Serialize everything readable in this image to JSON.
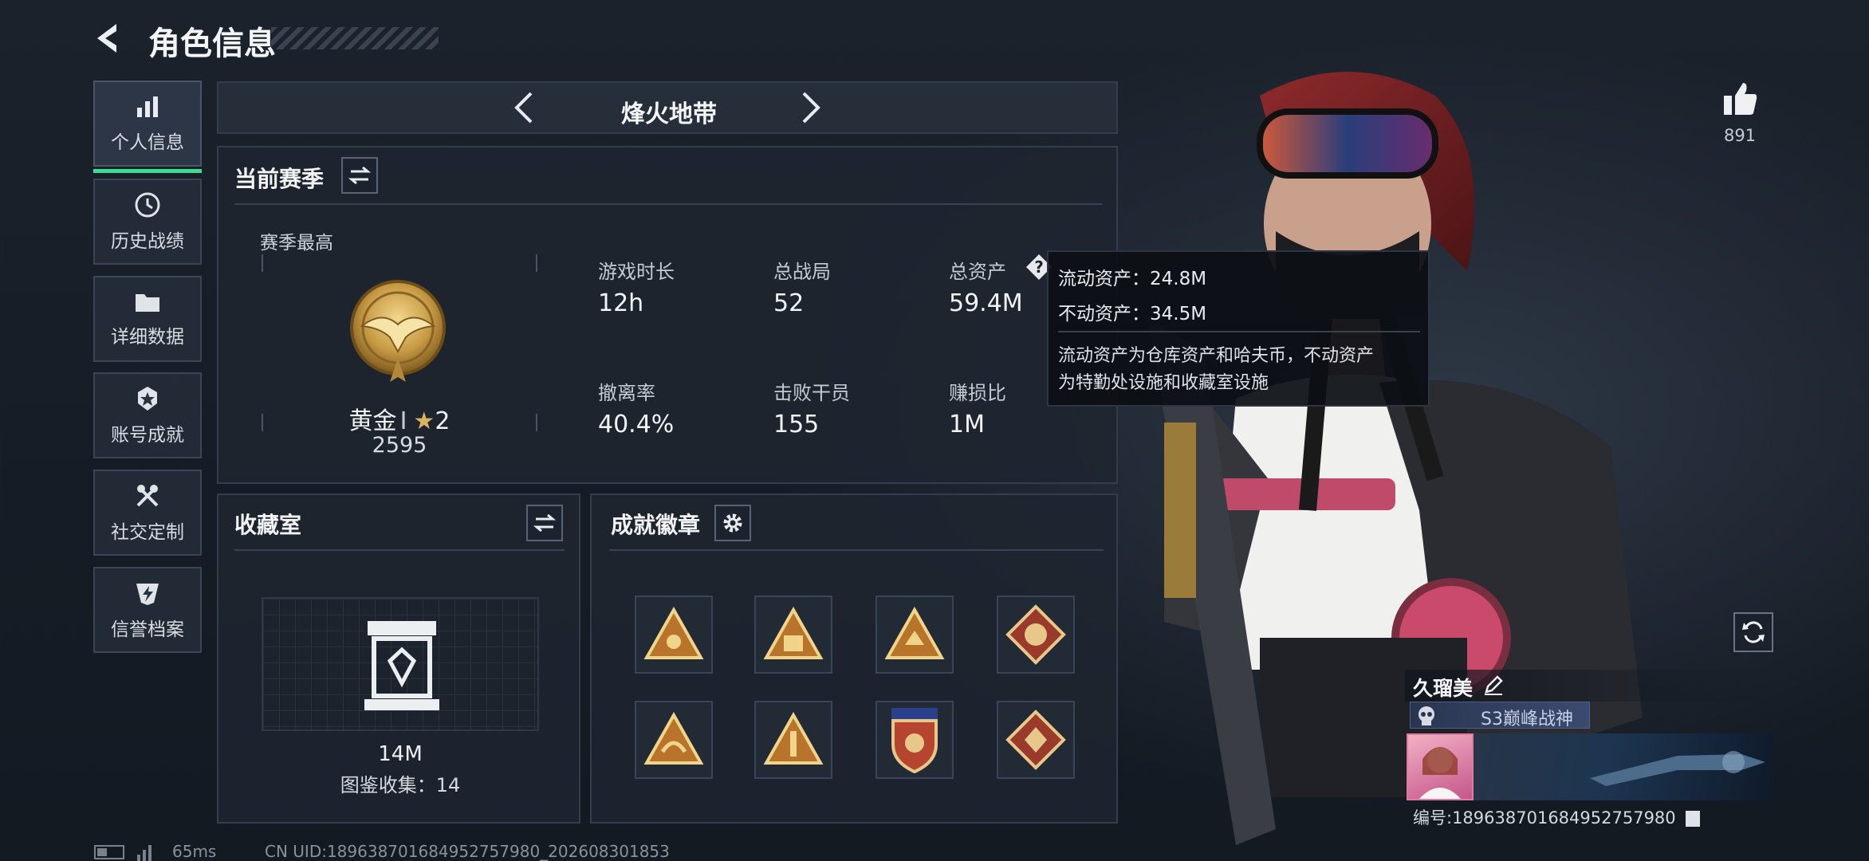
{
  "header": {
    "title": "角色信息"
  },
  "sidebar": {
    "items": [
      {
        "label": "个人信息"
      },
      {
        "label": "历史战绩"
      },
      {
        "label": "详细数据"
      },
      {
        "label": "账号成就"
      },
      {
        "label": "社交定制"
      },
      {
        "label": "信誉档案"
      }
    ]
  },
  "mode": {
    "title": "烽火地带"
  },
  "season": {
    "title": "当前赛季",
    "best_label": "赛季最高",
    "rank_name": "黄金",
    "rank_tier": "Ⅰ",
    "rank_stars": "2",
    "rank_score": "2595",
    "stats": [
      {
        "label": "游戏时长",
        "value": "12h"
      },
      {
        "label": "总战局",
        "value": "52"
      },
      {
        "label": "总资产",
        "value": "59.4M"
      },
      {
        "label": "撤离率",
        "value": "40.4%"
      },
      {
        "label": "击败干员",
        "value": "155"
      },
      {
        "label": "赚损比",
        "value": "1M"
      }
    ]
  },
  "tooltip": {
    "liquid": "流动资产：24.8M",
    "fixed": "不动资产：34.5M",
    "desc_line1": "流动资产为仓库资产和哈夫币，不动资产",
    "desc_line2": "为特勤处设施和收藏室设施"
  },
  "collection": {
    "title": "收藏室",
    "value": "14M",
    "catalog": "图鉴收集：14"
  },
  "achievements": {
    "title": "成就徽章"
  },
  "likes": {
    "count": "891"
  },
  "player": {
    "name": "久瑠美",
    "title_badge": "S3巅峰战神",
    "id_line": "编号:18963870168495275798​0"
  },
  "status": {
    "ping": "65ms",
    "uid": "CN UID:18963870168495275798​0_202608301853"
  },
  "colors": {
    "accent": "#3ddc97",
    "gold": "#c9a355",
    "badge_bg": "#b8742a"
  }
}
